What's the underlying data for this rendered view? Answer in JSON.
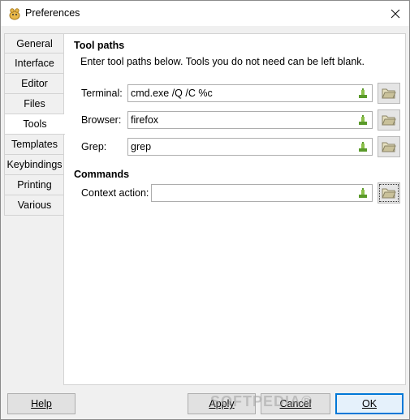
{
  "window": {
    "title": "Preferences"
  },
  "sidebar": {
    "tabs": [
      {
        "label": "General"
      },
      {
        "label": "Interface"
      },
      {
        "label": "Editor"
      },
      {
        "label": "Files"
      },
      {
        "label": "Tools",
        "active": true
      },
      {
        "label": "Templates"
      },
      {
        "label": "Keybindings"
      },
      {
        "label": "Printing"
      },
      {
        "label": "Various"
      }
    ]
  },
  "tool_paths": {
    "heading": "Tool paths",
    "description": "Enter tool paths below. Tools you do not need can be left blank.",
    "terminal": {
      "label": "Terminal:",
      "value": "cmd.exe /Q /C %c"
    },
    "browser": {
      "label": "Browser:",
      "value": "firefox"
    },
    "grep": {
      "label": "Grep:",
      "value": "grep"
    }
  },
  "commands": {
    "heading": "Commands",
    "context_action": {
      "label": "Context action:",
      "value": ""
    }
  },
  "footer": {
    "help": "Help",
    "apply": "Apply",
    "cancel": "Cancel",
    "ok": "OK"
  },
  "watermark": "SOFTPEDIA®",
  "colors": {
    "accent": "#0078d7",
    "icon_green": "#5a9a2a",
    "folder_tan": "#c9c19a"
  }
}
